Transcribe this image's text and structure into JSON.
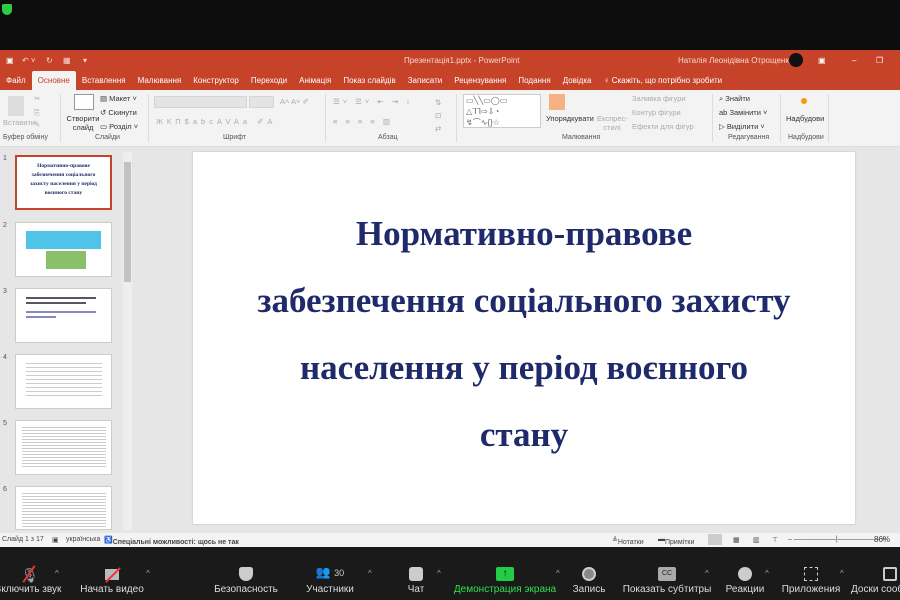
{
  "zoom_top": {
    "shield_color": "#2ecc40"
  },
  "titlebar": {
    "title": "Презентація1.pptx - PowerPoint",
    "user": "Наталія Леонідівна Отрощенко"
  },
  "tabs": [
    "Файл",
    "Основне",
    "Вставлення",
    "Малювання",
    "Конструктор",
    "Переходи",
    "Анімація",
    "Показ слайдів",
    "Записати",
    "Рецензування",
    "Подання",
    "Довідка"
  ],
  "tell_me": "Скажіть, що потрібно зробити",
  "ribbon": {
    "paste": "Вставити",
    "clipboard": "Буфер обміну",
    "new_slide": "Створити слайд",
    "layout": "Макет",
    "reset": "Скинути",
    "section": "Розділ",
    "slides": "Слайди",
    "font": "Шрифт",
    "paragraph": "Абзац",
    "arrange": "Упорядкувати",
    "quick_styles": "Експрес-стилі",
    "shape_fill": "Заливка фігури",
    "shape_outline": "Контур фігури",
    "shape_effects": "Ефекти для фігур",
    "drawing": "Малювання",
    "find": "Знайти",
    "replace": "Замінити",
    "select": "Виділити",
    "editing": "Редагування",
    "addins_btn": "Надбудови",
    "addins": "Надбудови"
  },
  "thumbnails": [
    {
      "num": "1",
      "text": "Нормативно-правове забезпечення соціального захисту населення у період воєнного стану"
    },
    {
      "num": "2"
    },
    {
      "num": "3"
    },
    {
      "num": "4"
    },
    {
      "num": "5"
    },
    {
      "num": "6"
    }
  ],
  "slide": {
    "title": "Нормативно-правове забезпечення соціального захисту населення у період воєнного стану",
    "title_color": "#1f2a6b"
  },
  "status": {
    "slide": "Слайд 1 з 17",
    "language": "українська",
    "accessibility": "Спеціальні можливості: щось не так",
    "notes": "Нотатки",
    "comments": "Примітки",
    "zoom": "86%"
  },
  "zoom_toolbar": {
    "mute": "Включить звук",
    "video": "Начать видео",
    "security": "Безопасность",
    "participants": "Участники",
    "participants_count": "30",
    "chat": "Чат",
    "share": "Демонстрация экрана",
    "record": "Запись",
    "captions": "Показать субтитры",
    "reactions": "Реакции",
    "apps": "Приложения",
    "whiteboards": "Доски сообщений"
  }
}
